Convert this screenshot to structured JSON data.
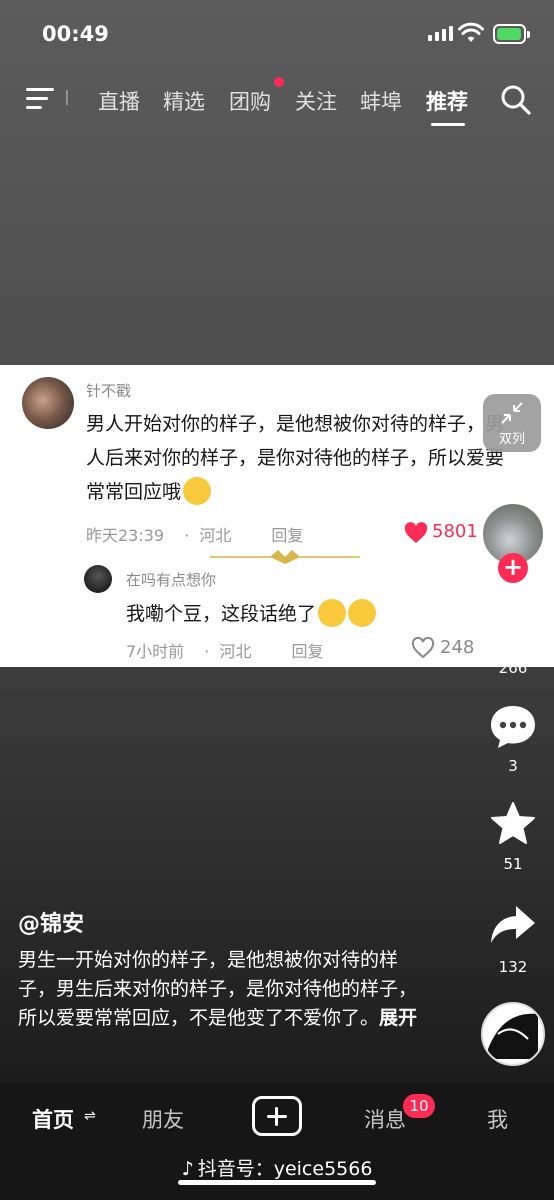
{
  "status_bar": {
    "time": "00:49"
  },
  "top_nav": {
    "faded_item": "\u0010",
    "items": [
      "直播",
      "精选",
      "团购",
      "关注",
      "蚌埠",
      "推荐"
    ],
    "active": "推荐"
  },
  "comment": {
    "username": "针不戳",
    "text": "男人开始对你的样子，是他想被你对待的样子，男人后来对你的样子，是你对待他的样子，所以爱要常常回应哦",
    "time": "昨天23:39",
    "location": "河北",
    "reply_label": "回复",
    "likes": "5801",
    "reply": {
      "username": "在吗有点想你",
      "text": "我嘞个豆，这段话绝了",
      "time": "7小时前",
      "location": "河北",
      "reply_label": "回复",
      "likes": "248"
    }
  },
  "collapse_button": {
    "label": "双列"
  },
  "side_actions": {
    "like_count": "266",
    "comment_count": "3",
    "favorite_count": "51",
    "share_count": "132"
  },
  "video": {
    "author": "@锦安",
    "description": "男生一开始对你的样子，是他想被你对待的样子，男生后来对你的样子，是你对待他的样子，所以爱要常常回应，不是他变了不爱你了。",
    "expand_label": "展开"
  },
  "tab_bar": {
    "home": "首页",
    "friends": "朋友",
    "messages": "消息",
    "messages_badge": "10",
    "me": "我"
  },
  "footer": {
    "douyin_id": "抖音号：yeice5566"
  },
  "colors": {
    "accent": "#fe2c55",
    "success": "#4cd964"
  }
}
